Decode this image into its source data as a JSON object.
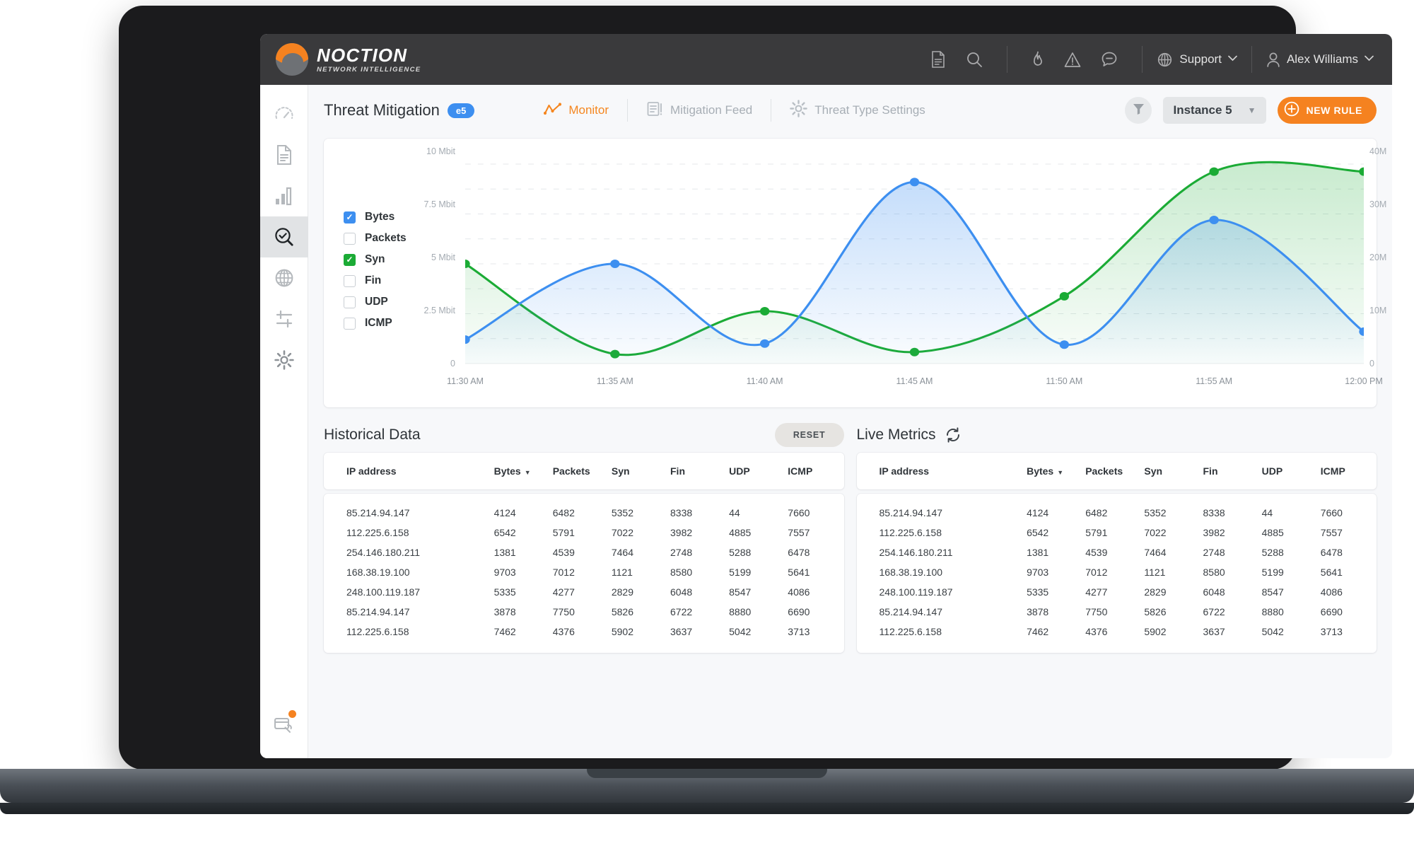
{
  "brand": {
    "name": "NOCTION",
    "tagline": "NETWORK INTELLIGENCE"
  },
  "topbar": {
    "icons": [
      {
        "name": "document-icon",
        "glyph": "document"
      },
      {
        "name": "search-icon",
        "glyph": "search"
      },
      {
        "name": "flame-icon",
        "glyph": "flame"
      },
      {
        "name": "warning-icon",
        "glyph": "warning"
      },
      {
        "name": "chat-icon",
        "glyph": "chat"
      }
    ],
    "support_label": "Support",
    "user_label": "Alex Williams",
    "caret": "⌄"
  },
  "sidebar": {
    "items": [
      {
        "name": "sidebar-item-dashboard",
        "icon": "gauge-icon",
        "active": false
      },
      {
        "name": "sidebar-item-reports",
        "icon": "document-icon",
        "active": false
      },
      {
        "name": "sidebar-item-analytics",
        "icon": "bar-chart-icon",
        "active": false
      },
      {
        "name": "sidebar-item-threat-mitigation",
        "icon": "magnifier-check-icon",
        "active": true
      },
      {
        "name": "sidebar-item-network",
        "icon": "globe-icon",
        "active": false
      },
      {
        "name": "sidebar-item-settings-sliders",
        "icon": "sliders-icon",
        "active": false
      },
      {
        "name": "sidebar-item-configuration",
        "icon": "gear-icon",
        "active": false
      }
    ],
    "bottom_item": {
      "name": "sidebar-item-maintenance",
      "icon": "tools-icon",
      "has_badge": true
    }
  },
  "page": {
    "title": "Threat Mitigation",
    "badge": "e5",
    "tabs": [
      {
        "label": "Monitor",
        "icon": "line-chart-icon",
        "active": true
      },
      {
        "label": "Mitigation Feed",
        "icon": "feed-icon",
        "active": false
      },
      {
        "label": "Threat Type Settings",
        "icon": "gear-icon",
        "active": false
      }
    ],
    "filter_icon": "funnel-icon",
    "instance_value": "Instance 5",
    "instance_caret": "▼",
    "new_rule_label": "NEW RULE"
  },
  "colors": {
    "accent_orange": "#f58220",
    "blue": "#3d8ff0",
    "green": "#1bab35",
    "badge_blue": "#3d8ff0"
  },
  "chart_data": {
    "type": "line",
    "title": "",
    "xlabel": "",
    "ylabel": "",
    "grid": true,
    "legend_position": "left",
    "x": [
      "11:30 AM",
      "11:35 AM",
      "11:40 AM",
      "11:45 AM",
      "11:50 AM",
      "11:55 AM",
      "12:00 PM"
    ],
    "xticklabels": [
      "11:30 AM",
      "11:35 AM",
      "11:40 AM",
      "11:45 AM",
      "11:50 AM",
      "11:55 AM",
      "12:00 PM"
    ],
    "left_axis": {
      "label": "Mbit",
      "ticks": [
        0,
        2.5,
        5,
        7.5,
        10
      ],
      "ticklabels": [
        "0",
        "2.5 Mbit",
        "5 Mbit",
        "7.5 Mbit",
        "10 Mbit"
      ],
      "ylim": [
        0,
        10
      ]
    },
    "right_axis": {
      "label": "",
      "ticks": [
        0,
        10,
        20,
        30,
        40
      ],
      "ticklabels": [
        "0",
        "10M",
        "20M",
        "30M",
        "40M"
      ],
      "ylim": [
        0,
        40
      ]
    },
    "series": [
      {
        "name": "Bytes",
        "axis": "left",
        "color": "#3d8ff0",
        "checked": true,
        "values": [
          1.2,
          5.0,
          1.0,
          9.1,
          0.95,
          7.2,
          1.6
        ]
      },
      {
        "name": "Syn",
        "axis": "right",
        "color": "#1bab35",
        "checked": true,
        "values": [
          20.0,
          1.9,
          10.5,
          2.3,
          13.5,
          38.5,
          38.5
        ]
      }
    ],
    "legend": [
      {
        "label": "Bytes",
        "checked": true,
        "color": "#3d8ff0"
      },
      {
        "label": "Packets",
        "checked": false,
        "color": "#c9ced3"
      },
      {
        "label": "Syn",
        "checked": true,
        "color": "#1bab35"
      },
      {
        "label": "Fin",
        "checked": false,
        "color": "#c9ced3"
      },
      {
        "label": "UDP",
        "checked": false,
        "color": "#c9ced3"
      },
      {
        "label": "ICMP",
        "checked": false,
        "color": "#c9ced3"
      }
    ]
  },
  "historical": {
    "title": "Historical Data",
    "reset_label": "RESET",
    "columns": [
      "IP address",
      "Bytes",
      "Packets",
      "Syn",
      "Fin",
      "UDP",
      "ICMP"
    ],
    "sorted_column": "Bytes",
    "sort_caret": "▼",
    "rows": [
      [
        "85.214.94.147",
        "4124",
        "6482",
        "5352",
        "8338",
        "44",
        "7660"
      ],
      [
        "112.225.6.158",
        "6542",
        "5791",
        "7022",
        "3982",
        "4885",
        "7557"
      ],
      [
        "254.146.180.211",
        "1381",
        "4539",
        "7464",
        "2748",
        "5288",
        "6478"
      ],
      [
        "168.38.19.100",
        "9703",
        "7012",
        "1121",
        "8580",
        "5199",
        "5641"
      ],
      [
        "248.100.119.187",
        "5335",
        "4277",
        "2829",
        "6048",
        "8547",
        "4086"
      ],
      [
        "85.214.94.147",
        "3878",
        "7750",
        "5826",
        "6722",
        "8880",
        "6690"
      ],
      [
        "112.225.6.158",
        "7462",
        "4376",
        "5902",
        "3637",
        "5042",
        "3713"
      ]
    ]
  },
  "live": {
    "title": "Live Metrics",
    "refresh_icon": "refresh-icon",
    "columns": [
      "IP address",
      "Bytes",
      "Packets",
      "Syn",
      "Fin",
      "UDP",
      "ICMP"
    ],
    "sorted_column": "Bytes",
    "sort_caret": "▼",
    "rows": [
      [
        "85.214.94.147",
        "4124",
        "6482",
        "5352",
        "8338",
        "44",
        "7660"
      ],
      [
        "112.225.6.158",
        "6542",
        "5791",
        "7022",
        "3982",
        "4885",
        "7557"
      ],
      [
        "254.146.180.211",
        "1381",
        "4539",
        "7464",
        "2748",
        "5288",
        "6478"
      ],
      [
        "168.38.19.100",
        "9703",
        "7012",
        "1121",
        "8580",
        "5199",
        "5641"
      ],
      [
        "248.100.119.187",
        "5335",
        "4277",
        "2829",
        "6048",
        "8547",
        "4086"
      ],
      [
        "85.214.94.147",
        "3878",
        "7750",
        "5826",
        "6722",
        "8880",
        "6690"
      ],
      [
        "112.225.6.158",
        "7462",
        "4376",
        "5902",
        "3637",
        "5042",
        "3713"
      ]
    ]
  }
}
